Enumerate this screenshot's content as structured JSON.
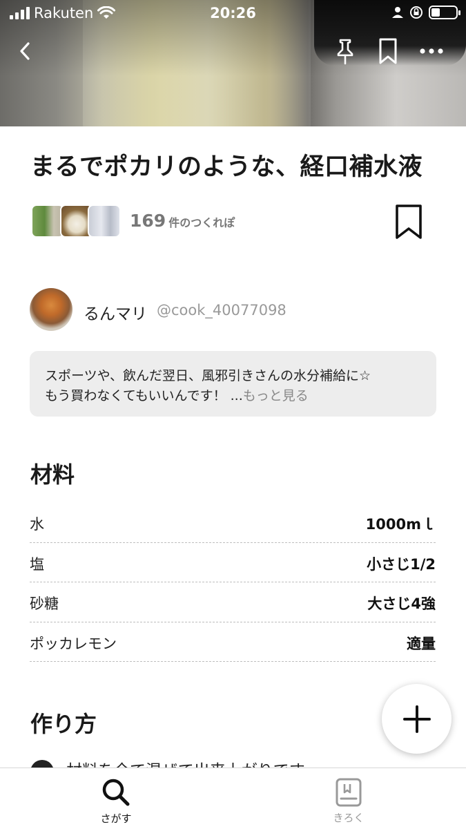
{
  "status_bar": {
    "carrier": "Rakuten",
    "time": "20:26"
  },
  "header": {
    "back_icon": "chevron-left-icon",
    "pin_icon": "pin-icon",
    "bookmark_icon": "bookmark-outline-icon",
    "more_icon": "more-horizontal-icon"
  },
  "recipe": {
    "title": "まるでポカリのような、経口補水液",
    "tsukurepo_count": "169",
    "tsukurepo_label": "件のつくれぽ",
    "author": {
      "name": "るんマリ",
      "id": "@cook_40077098"
    },
    "description_line1": "スポーツや、飲んだ翌日、風邪引きさんの水分補給に☆",
    "description_line2": "もう買わなくてもいいんです！ ...",
    "more_link": "もっと見る"
  },
  "ingredients": {
    "heading": "材料",
    "items": [
      {
        "name": "水",
        "amount": "1000mｌ"
      },
      {
        "name": "塩",
        "amount": "小さじ1/2"
      },
      {
        "name": "砂糖",
        "amount": "大さじ4強"
      },
      {
        "name": "ポッカレモン",
        "amount": "適量"
      }
    ]
  },
  "steps": {
    "heading": "作り方",
    "first_step_text": "材料を全て混ぜて出来上がりです。"
  },
  "fab": {
    "icon": "plus-icon"
  },
  "tabbar": {
    "tabs": [
      {
        "label": "さがす",
        "icon": "search-icon",
        "active": true
      },
      {
        "label": "きろく",
        "icon": "notebook-icon",
        "active": false
      }
    ]
  },
  "colors": {
    "text": "#1a1a1a",
    "muted": "#888888",
    "desc_bg": "#ededed"
  }
}
